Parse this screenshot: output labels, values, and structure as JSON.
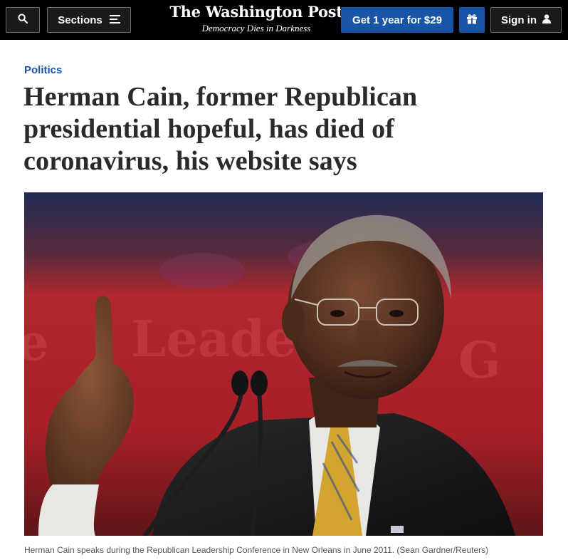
{
  "header": {
    "sections_label": "Sections",
    "logo_text": "The Washington Post",
    "tagline": "Democracy Dies in Darkness",
    "subscribe_label": "Get 1 year for $29",
    "signin_label": "Sign in",
    "colors": {
      "bar": "#000000",
      "accent": "#1955a5"
    }
  },
  "article": {
    "section": "Politics",
    "headline": "Herman Cain, former Republican presidential hopeful, has died of coronavirus, his website says",
    "image": {
      "caption": "Herman Cain speaks during the Republican Leadership Conference in New Orleans in June 2011. (Sean Gardner/Reuters)"
    }
  },
  "icons": {
    "search": "search-icon",
    "menu": "hamburger-icon",
    "gift": "gift-icon",
    "user": "user-icon"
  }
}
